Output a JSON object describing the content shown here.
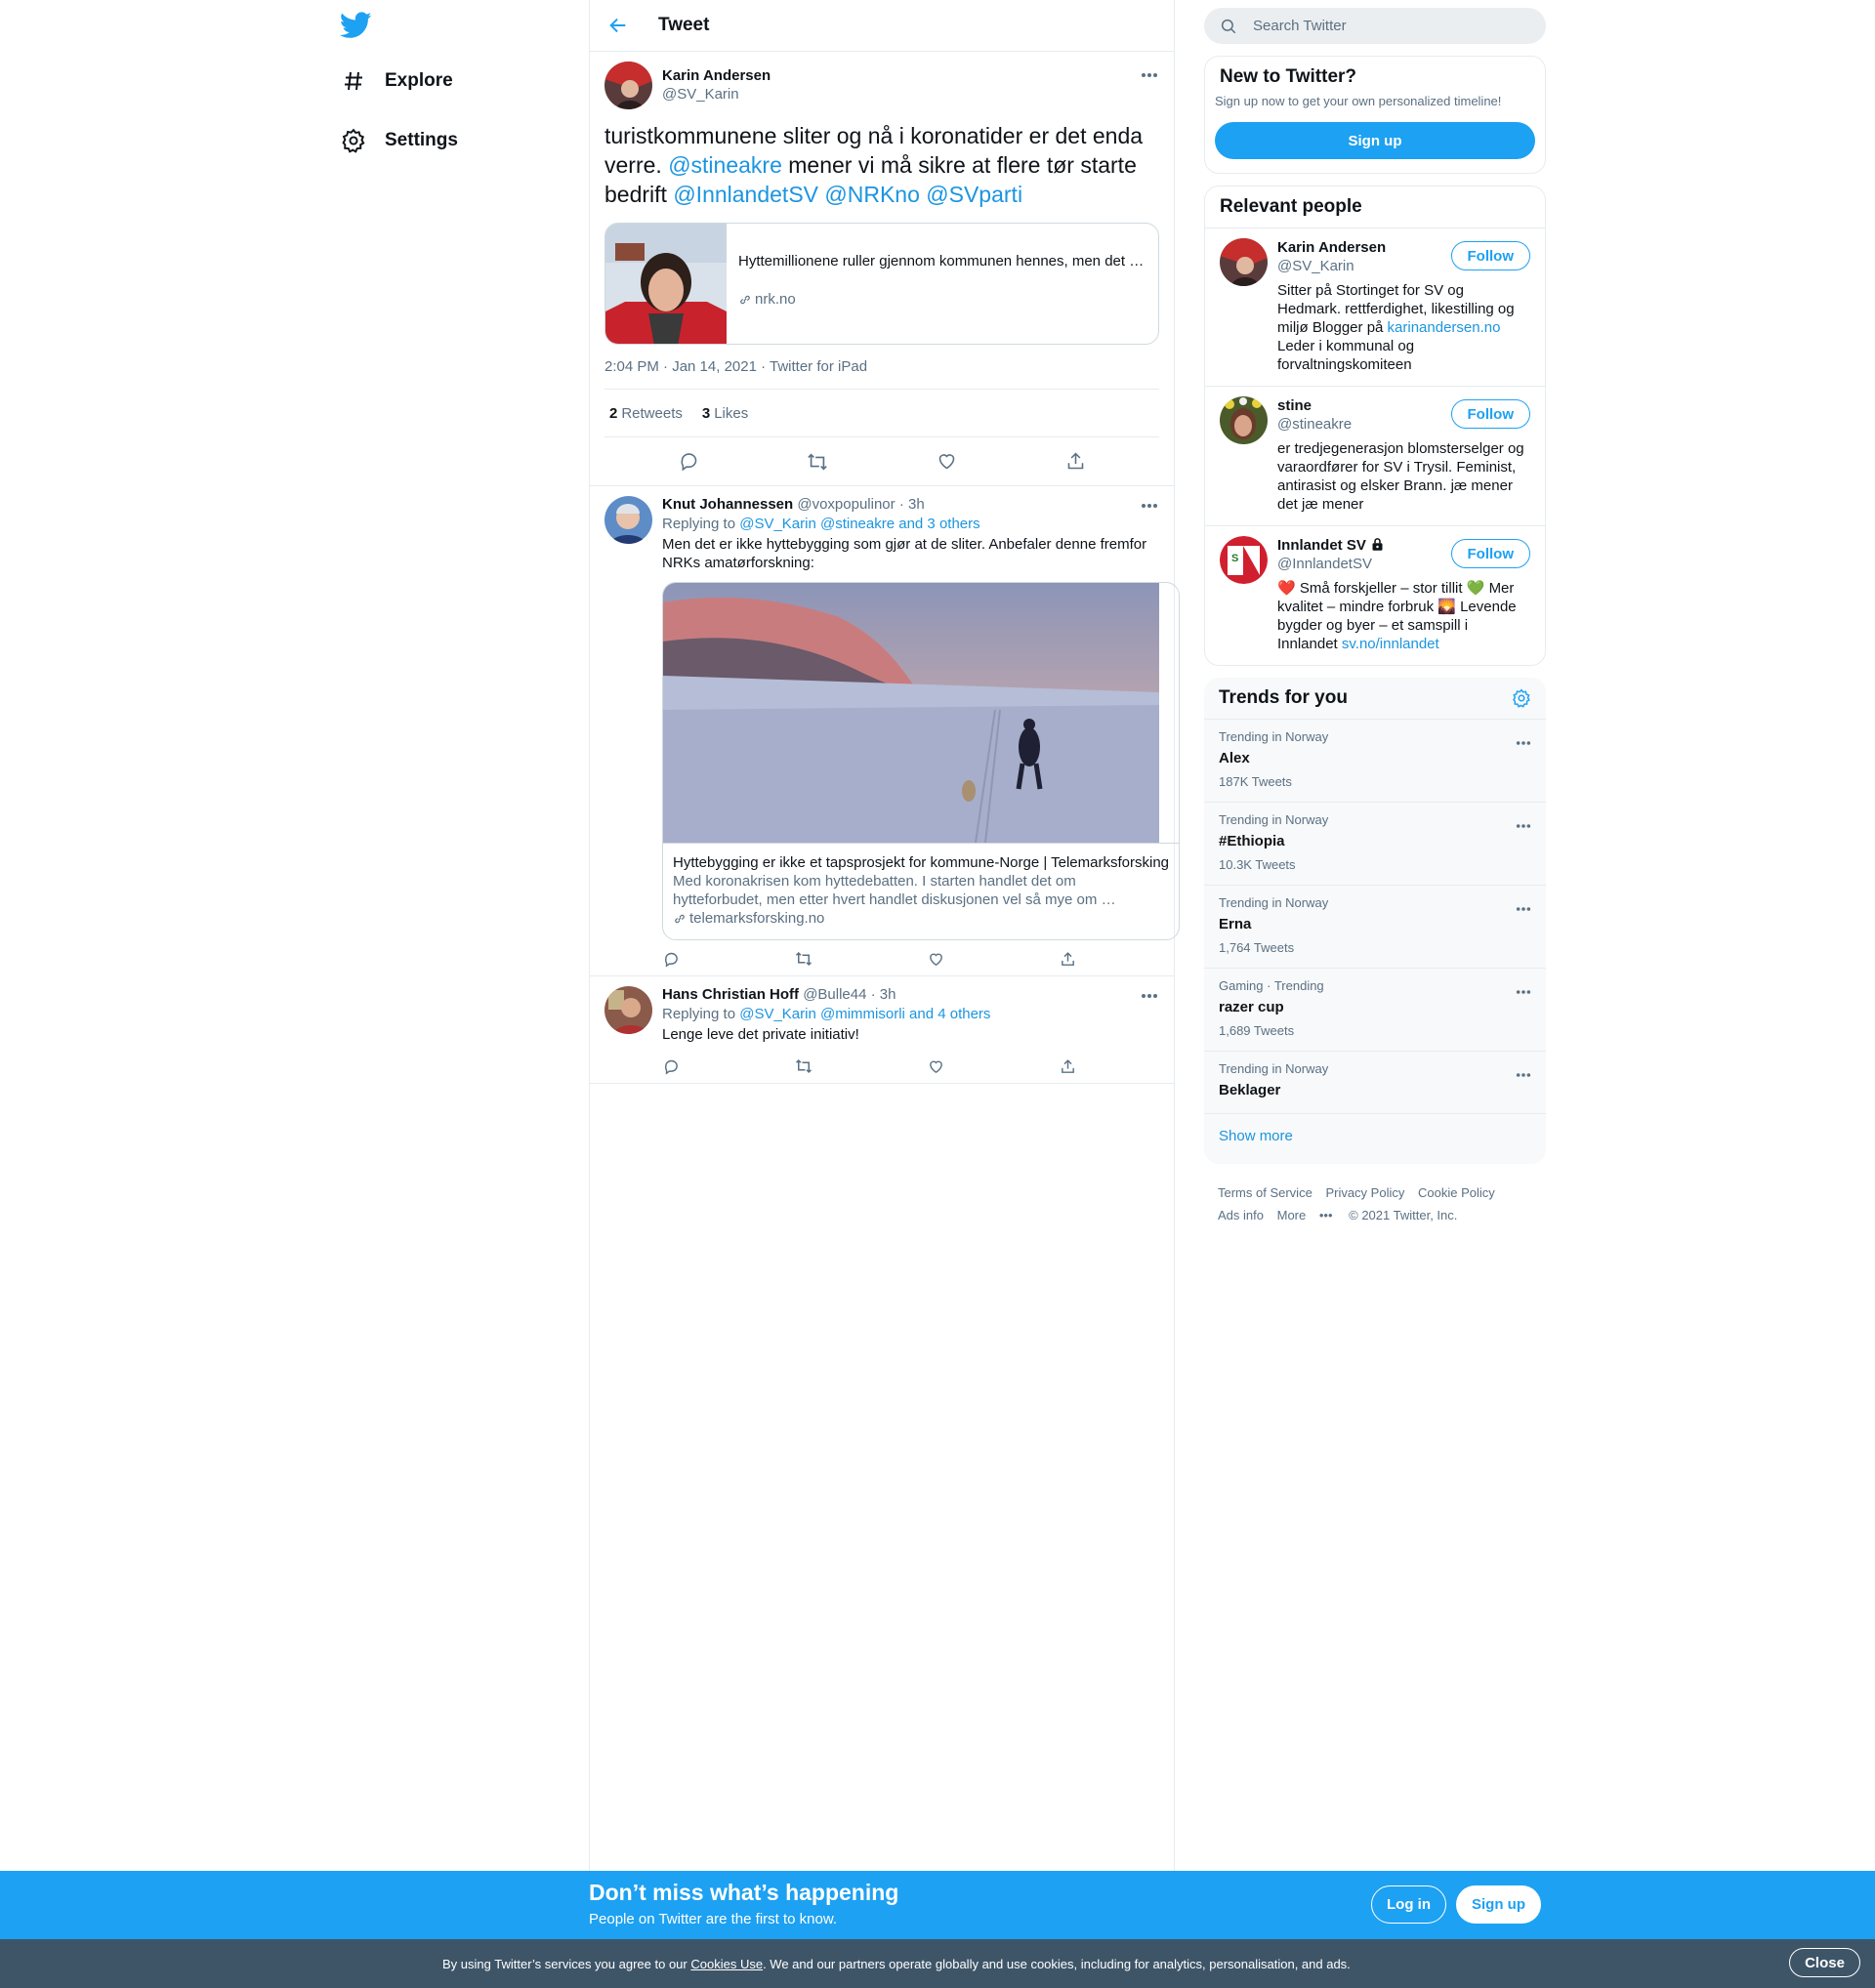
{
  "nav": {
    "explore": "Explore",
    "settings": "Settings"
  },
  "header": {
    "title": "Tweet"
  },
  "main_tweet": {
    "author_name": "Karin Andersen",
    "author_handle": "@SV_Karin",
    "text_parts": {
      "t1": "turistkommunene sliter og nå i koronatider er det enda verre. ",
      "m1": "@stineakre",
      "t2": " mener vi må sikre at flere tør starte bedrift ",
      "m2": "@InnlandetSV",
      "m3": "@NRKno",
      "m4": "@SVparti"
    },
    "card": {
      "title": "Hyttemillionene ruller gjennom kommunen hennes, men det blir lite igjen",
      "domain": "nrk.no"
    },
    "time": "2:04 PM · Jan 14, 2021",
    "source": "Twitter for iPad",
    "retweets_count": "2",
    "retweets_label": "Retweets",
    "likes_count": "3",
    "likes_label": "Likes"
  },
  "replies": [
    {
      "name": "Knut Johannessen",
      "handle": "@voxpopulinor",
      "time": "· 3h",
      "replying_to": "Replying to",
      "replying_mentions": "@SV_Karin @stineakre and 3 others",
      "text": "Men det er ikke hyttebygging som gjør at de sliter. Anbefaler denne fremfor NRKs amatørforskning:",
      "card": {
        "title": "Hyttebygging er ikke et tapsprosjekt for kommune-Norge | Telemarksforsking",
        "desc": "Med koronakrisen kom hyttedebatten. I starten handlet det om hytteforbudet, men etter hvert handlet diskusjonen vel så mye om …",
        "domain": "telemarksforsking.no"
      }
    },
    {
      "name": "Hans Christian Hoff",
      "handle": "@Bulle44",
      "time": "· 3h",
      "replying_to": "Replying to",
      "replying_mentions": "@SV_Karin @mimmisorli and 4 others",
      "text": "Lenge leve det private initiativ!"
    }
  ],
  "search": {
    "placeholder": "Search Twitter"
  },
  "new_box": {
    "title": "New to Twitter?",
    "desc": "Sign up now to get your own personalized timeline!",
    "button": "Sign up"
  },
  "relevant": {
    "title": "Relevant people",
    "follow_label": "Follow",
    "people": [
      {
        "name": "Karin Andersen",
        "handle": "@SV_Karin",
        "bio_a": "Sitter på Stortinget for SV og Hedmark. rettferdighet, likestilling og miljø Blogger på ",
        "bio_link": "karinandersen.no",
        "bio_b": " Leder i kommunal og forvaltningskomiteen"
      },
      {
        "name": "stine",
        "handle": "@stineakre",
        "bio_a": "er tredjegenerasjon blomsterselger og varaordfører for SV i Trysil. Feminist, antirasist og elsker Brann. jæ mener det jæ mener"
      },
      {
        "name": "Innlandet SV",
        "handle": "@InnlandetSV",
        "bio_a": "❤️ Små forskjeller – stor tillit 💚 Mer kvalitet – mindre forbruk 🌄 Levende bygder og byer – et samspill i Innlandet ",
        "bio_link": "sv.no/innlandet"
      }
    ]
  },
  "trends": {
    "title": "Trends for you",
    "items": [
      {
        "context": "Trending in Norway",
        "name": "Alex",
        "count": "187K Tweets"
      },
      {
        "context": "Trending in Norway",
        "name": "#Ethiopia",
        "count": "10.3K Tweets"
      },
      {
        "context": "Trending in Norway",
        "name": "Erna",
        "count": "1,764 Tweets"
      },
      {
        "context": "Gaming · Trending",
        "name": "razer cup",
        "count": "1,689 Tweets"
      },
      {
        "context": "Trending in Norway",
        "name": "Beklager",
        "count": ""
      }
    ],
    "show_more": "Show more"
  },
  "footer": {
    "tos": "Terms of Service",
    "privacy": "Privacy Policy",
    "cookie": "Cookie Policy",
    "ads": "Ads info",
    "more": "More",
    "copyright": "© 2021 Twitter, Inc."
  },
  "bottom_bar": {
    "title": "Don’t miss what’s happening",
    "subtitle": "People on Twitter are the first to know.",
    "login": "Log in",
    "signup": "Sign up"
  },
  "cookie_bar": {
    "pre": "By using Twitter’s services you agree to our ",
    "link": "Cookies Use",
    "post": ". We and our partners operate globally and use cookies, including for analytics, personalisation, and ads.",
    "close": "Close"
  },
  "colors": {
    "accent": "#1da1f2",
    "link": "#1b95e0",
    "secondary_text": "#5b7083",
    "cookie_bar": "#3e5568"
  }
}
